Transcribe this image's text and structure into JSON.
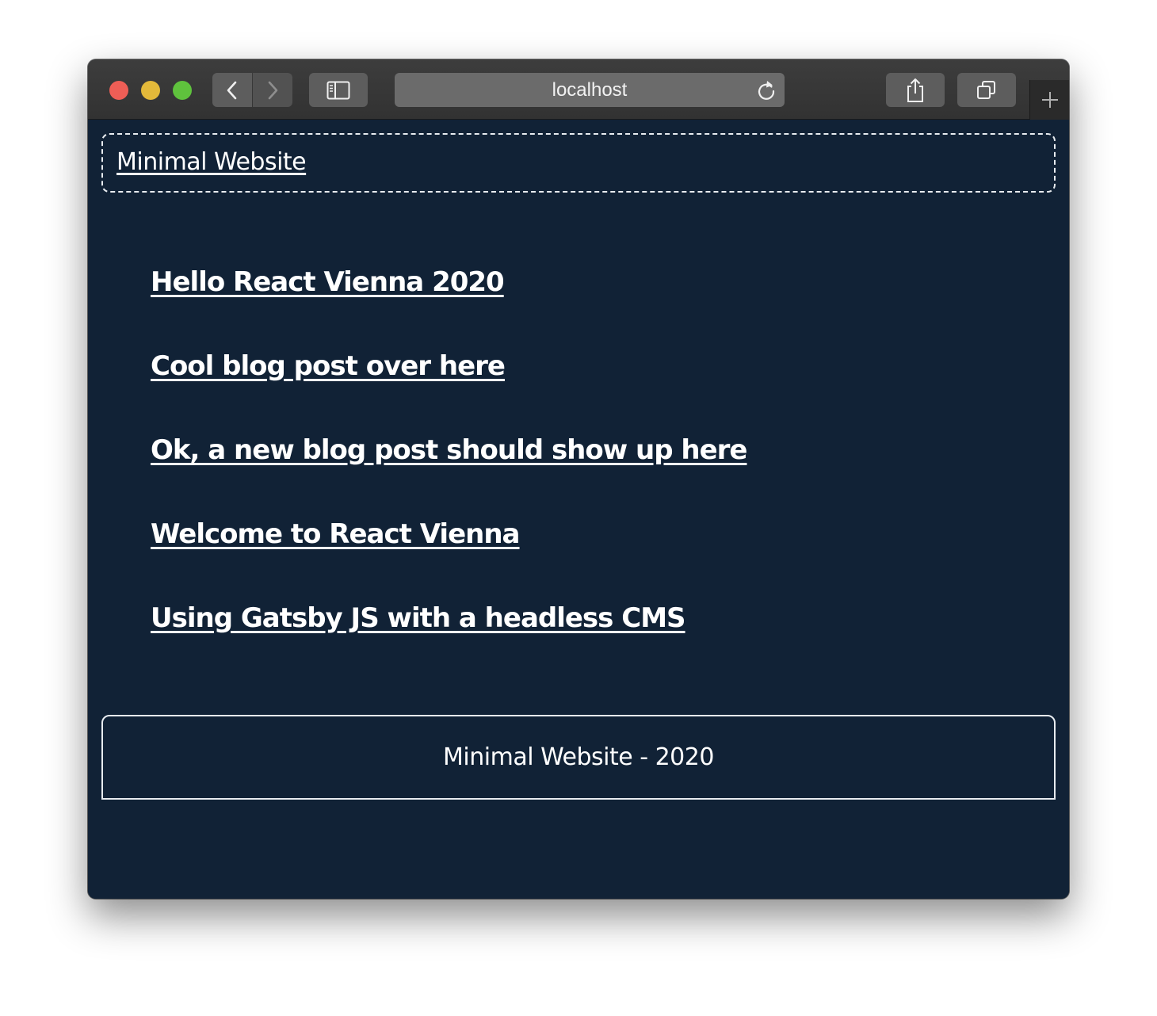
{
  "browser": {
    "url": "localhost",
    "icons": {
      "back": "chevron-left-icon",
      "forward": "chevron-right-icon",
      "sidebar": "sidebar-icon",
      "reload": "reload-icon",
      "share": "share-icon",
      "tabs": "tabs-icon",
      "new_tab": "plus-icon"
    },
    "traffic_light_colors": {
      "close": "#ee5e56",
      "minimize": "#e3b93a",
      "maximize": "#5fc23d"
    }
  },
  "page": {
    "background": "#112236",
    "header": {
      "site_title": "Minimal Website"
    },
    "posts": [
      {
        "title": "Hello React Vienna 2020"
      },
      {
        "title": "Cool blog post over here"
      },
      {
        "title": "Ok, a new blog post should show up here"
      },
      {
        "title": "Welcome to React Vienna"
      },
      {
        "title": "Using Gatsby JS with a headless CMS"
      }
    ],
    "footer": {
      "text": "Minimal Website - 2020"
    }
  }
}
